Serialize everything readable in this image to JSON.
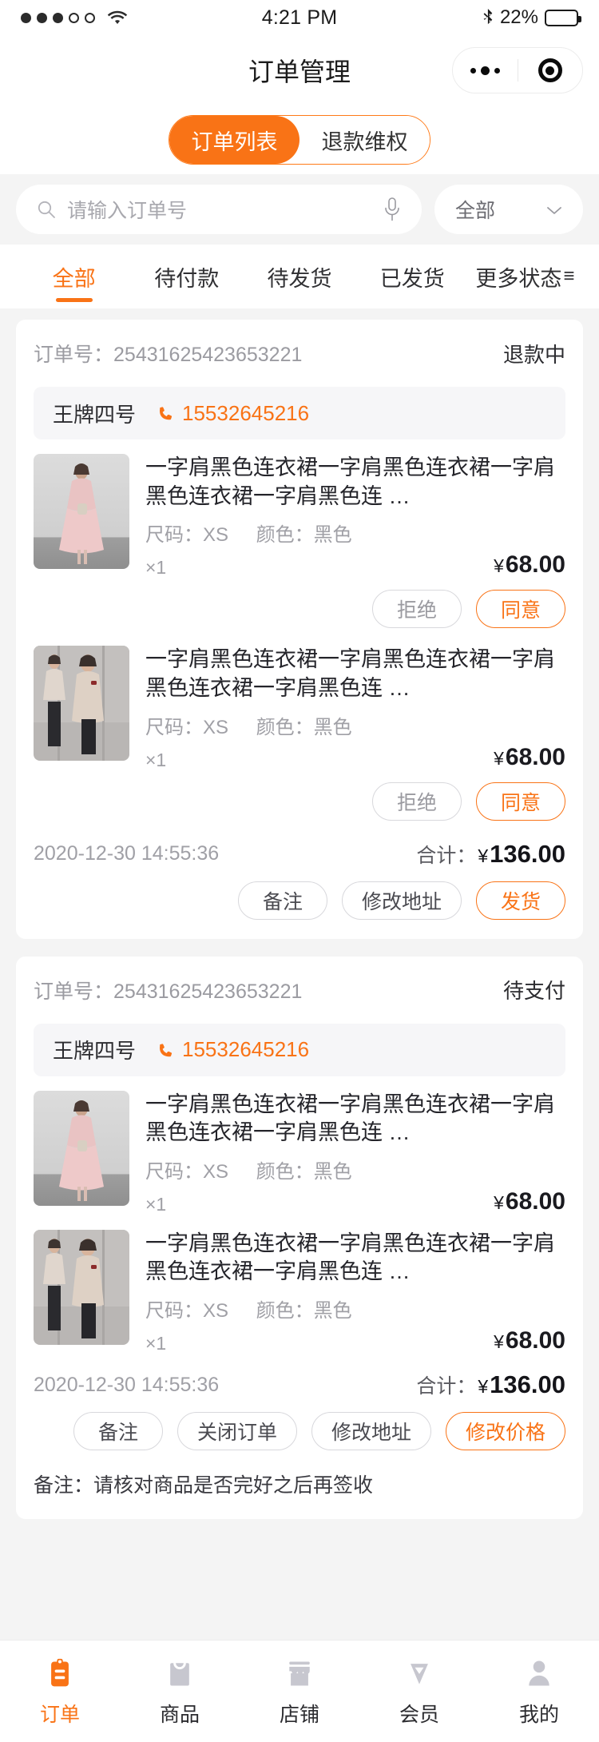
{
  "statusbar": {
    "time": "4:21 PM",
    "battery_percent": "22%",
    "signal_dots_filled": 3,
    "signal_dots_total": 5,
    "wifi_icon": "wifi-icon",
    "bluetooth_icon": "bluetooth-icon"
  },
  "navbar": {
    "title": "订单管理",
    "capsule": {
      "menu_icon": "more-dots-icon",
      "target_icon": "target-icon"
    }
  },
  "segmented": {
    "items": [
      {
        "label": "订单列表",
        "active": true
      },
      {
        "label": "退款维权",
        "active": false
      }
    ]
  },
  "search": {
    "placeholder": "请输入订单号",
    "value": "",
    "search_icon": "search-icon",
    "mic_icon": "microphone-icon",
    "filter_label": "全部",
    "filter_chevron": "chevron-down-icon"
  },
  "status_tabs": [
    {
      "label": "全部",
      "active": true
    },
    {
      "label": "待付款",
      "active": false
    },
    {
      "label": "待发货",
      "active": false
    },
    {
      "label": "已发货",
      "active": false
    },
    {
      "label": "更多状态",
      "active": false,
      "suffix": "≡"
    }
  ],
  "orders": [
    {
      "order_no_label": "订单号：",
      "order_no": "25431625423653221",
      "status": "退款中",
      "customer_name": "王牌四号",
      "customer_phone": "15532645216",
      "phone_icon": "phone-icon",
      "items": [
        {
          "title": "一字肩黑色连衣裙一字肩黑色连衣裙一字肩黑色连衣裙一字肩黑色连 …",
          "size_label": "尺码：XS",
          "color_label": "颜色：黑色",
          "qty": "×1",
          "currency": "¥",
          "price": "68.00",
          "image": "pink-dress-photo",
          "actions": [
            {
              "label": "拒绝",
              "style": "muted"
            },
            {
              "label": "同意",
              "style": "accent"
            }
          ]
        },
        {
          "title": "一字肩黑色连衣裙一字肩黑色连衣裙一字肩黑色连衣裙一字肩黑色连 …",
          "size_label": "尺码：XS",
          "color_label": "颜色：黑色",
          "qty": "×1",
          "currency": "¥",
          "price": "68.00",
          "image": "beige-coat-photo",
          "actions": [
            {
              "label": "拒绝",
              "style": "muted"
            },
            {
              "label": "同意",
              "style": "accent"
            }
          ]
        }
      ],
      "time": "2020-12-30 14:55:36",
      "total_label": "合计：",
      "total_currency": "¥",
      "total": "136.00",
      "actions": [
        {
          "label": "备注",
          "style": "plain"
        },
        {
          "label": "修改地址",
          "style": "plain"
        },
        {
          "label": "发货",
          "style": "accent"
        }
      ],
      "remark": ""
    },
    {
      "order_no_label": "订单号：",
      "order_no": "25431625423653221",
      "status": "待支付",
      "customer_name": "王牌四号",
      "customer_phone": "15532645216",
      "phone_icon": "phone-icon",
      "items": [
        {
          "title": "一字肩黑色连衣裙一字肩黑色连衣裙一字肩黑色连衣裙一字肩黑色连 …",
          "size_label": "尺码：XS",
          "color_label": "颜色：黑色",
          "qty": "×1",
          "currency": "¥",
          "price": "68.00",
          "image": "pink-dress-photo",
          "actions": []
        },
        {
          "title": "一字肩黑色连衣裙一字肩黑色连衣裙一字肩黑色连衣裙一字肩黑色连 …",
          "size_label": "尺码：XS",
          "color_label": "颜色：黑色",
          "qty": "×1",
          "currency": "¥",
          "price": "68.00",
          "image": "beige-coat-photo",
          "actions": []
        }
      ],
      "time": "2020-12-30 14:55:36",
      "total_label": "合计：",
      "total_currency": "¥",
      "total": "136.00",
      "actions": [
        {
          "label": "备注",
          "style": "plain"
        },
        {
          "label": "关闭订单",
          "style": "plain"
        },
        {
          "label": "修改地址",
          "style": "plain"
        },
        {
          "label": "修改价格",
          "style": "accent"
        }
      ],
      "remark": "备注：请核对商品是否完好之后再签收"
    }
  ],
  "tabbar": [
    {
      "label": "订单",
      "icon": "clipboard-icon",
      "active": true
    },
    {
      "label": "商品",
      "icon": "shopping-bag-icon",
      "active": false
    },
    {
      "label": "店铺",
      "icon": "store-icon",
      "active": false
    },
    {
      "label": "会员",
      "icon": "diamond-icon",
      "active": false
    },
    {
      "label": "我的",
      "icon": "person-icon",
      "active": false
    }
  ],
  "colors": {
    "accent": "#F97316",
    "page_bg": "#f4f4f4",
    "card_bg": "#ffffff",
    "muted_text": "#a0a0a6",
    "tabbar_inactive": "#c7c7cf"
  }
}
